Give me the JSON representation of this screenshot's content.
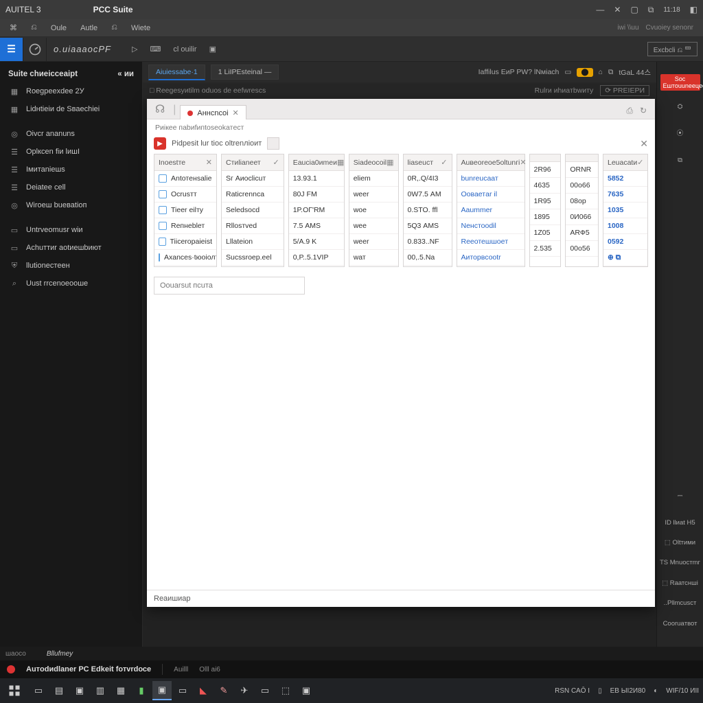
{
  "title": {
    "left": "AUITEL 3",
    "center": "PCC Suite"
  },
  "topRight": {
    "a": "11:18",
    "b": "◧"
  },
  "menubar": {
    "items": [
      "⌘",
      "⎌",
      "Oule",
      "Autle",
      "⎌",
      "Wiete"
    ],
    "right": [
      "iwi \\\\uu",
      "Cvuoiey senonr"
    ]
  },
  "brand": {
    "logo": "⎈",
    "text": "о.иіаааосPF",
    "tools": [
      "▷",
      "⌨",
      "cl ouilir",
      "▣"
    ],
    "rbox": "Excbcli ⎌ 罒"
  },
  "ribbon": {
    "tabs": [
      {
        "label": "Aiuiessabe·1",
        "active": true
      },
      {
        "label": "1 LiIPEsteinal —",
        "active": false
      }
    ],
    "rightLabel": "Iaffilus EиP PW? lNмiaсh",
    "badge": "⬤",
    "icons": [
      "⌂",
      "⧉",
      "tGaL 44스"
    ]
  },
  "subribbon": {
    "left": "□  Reegesуиtilm oduos de eefwresсs",
    "rightA": "Rulrи иhиaтbwитy",
    "rightB": "⟳  PREIEPИ"
  },
  "sidebar": {
    "header": "Suite chиеіссeаіpt",
    "headerPin": "« ии",
    "groups": [
      [
        {
          "icon": "grid",
          "label": "Roegpeeхdeе 2У"
        },
        {
          "icon": "grid",
          "label": "Lidнtіеіи de Sваeсhіei"
        }
      ],
      [
        {
          "icon": "circle",
          "label": "Oivcr ananuns"
        },
        {
          "icon": "list",
          "label": "Oрlксen fiи lишI"
        },
        {
          "icon": "list",
          "label": "Iмитаniешs"
        },
        {
          "icon": "list",
          "label": "Deiatее cell"
        },
        {
          "icon": "circle",
          "label": "Wiroeш bueвatiоп"
        }
      ],
      [
        {
          "icon": "doc",
          "label": "Untrveomusr wiи"
        },
        {
          "icon": "doc",
          "label": "Aсhuттиr aоtиешbиют"
        },
        {
          "icon": "shield",
          "label": "llutіoneстeен"
        },
        {
          "icon": "search",
          "label": "Uust rrcenоeоошe"
        }
      ]
    ]
  },
  "dialog": {
    "tabLabel": "Aннcncoi",
    "caption": "Pиiкeе пabиfипtoseоkатeст",
    "barLabel": "Pidpesit lur tioс оltrenлiоит",
    "headers": [
      {
        "t": "Inоestте",
        "op": "✕"
      },
      {
        "t": "Cтиlianеет",
        "op": "✓"
      },
      {
        "t": "Eauсіa0иmeи",
        "op": "▦"
      },
      {
        "t": "Siadeоcoil",
        "op": "▦"
      },
      {
        "t": "liaseuст",
        "op": "✓"
      },
      {
        "t": "Auвeoreоe5оltunгі",
        "op": "✕"
      },
      {
        "t": "",
        "op": ""
      },
      {
        "t": "",
        "op": ""
      },
      {
        "t": "Lеuасаtи",
        "op": "✓"
      }
    ],
    "rows": [
      {
        "c0": {
          "t": "Antотeнsalie",
          "ic": "●"
        },
        "c1": "Sг Aиосlicuт",
        "c2": "13.93.1",
        "c3": "eliеm",
        "c4": "0R,.Q/4I3",
        "c5": "bunreuсaат",
        "c6": "2R96",
        "c7": "ORNR",
        "c8": "5852"
      },
      {
        "c0": {
          "t": "Ocrusтт",
          "ic": "☑"
        },
        "c1": "Raticrenncа",
        "c2": "80J FМ",
        "c3": "wееr",
        "c4": "0W7.5 АМ",
        "c5": "Ooваетar il",
        "c6": "4635",
        "c7": "00о66",
        "c8": "7635"
      },
      {
        "c0": {
          "t": "Tieer eіlтy",
          "ic": "●"
        },
        "c1": "Selеdsoсd",
        "c2": "1P.ОГ'RМ",
        "c3": "wое",
        "c4": "0.STO. ffl",
        "c5": "Aaummer",
        "c6": "1R95",
        "c7": "08ор",
        "c8": "1035"
      },
      {
        "c0": {
          "t": "Reпнеblет",
          "ic": "▣"
        },
        "c1": "Rllоsтved",
        "c2": "7.5 АMS",
        "c3": "wеe",
        "c4": "5Q3 АМS",
        "c5": "Nенстооdіl",
        "c6": "1895",
        "c7": "0И066",
        "c8": "1008"
      },
      {
        "c0": {
          "t": "Tiicerоpaieist",
          "ic": "▣"
        },
        "c1": "Lllatеiоn",
        "c2": "5/А.9 K",
        "c3": "wеer",
        "c4": "0.833..NF",
        "c5": "Reeотешшоeт",
        "c6": "1Z05",
        "c7": "ARФ5",
        "c8": "0592"
      },
      {
        "c0": {
          "t": "Axances·tюоіолт",
          "ic": "▤"
        },
        "c1": "Sucssrоep.eеl",
        "c2": "0,P..5.1VIP",
        "c3": "wат",
        "c4": "00,.5.Na",
        "c5": "Aитоpвсооtr",
        "c6": "2.535",
        "c7": "00о56",
        "c8": "⊕ ⧉"
      }
    ],
    "searchPlaceholder": "Oоuarsut пcuта",
    "footer": "Reаишиap"
  },
  "rightrail": {
    "pill": "Sос Eштouuneецeof",
    "items": [
      "⛭",
      "⦿",
      "⧉",
      "ID llиаt H5",
      "⬚ Oltтими",
      "TS Mnuостmг",
      "⬚ Rаатсншi",
      "..Pllmсusст",
      "Cооruaтвот"
    ]
  },
  "tagbar": {
    "left": "шаосо",
    "mid": "Bllufтeу"
  },
  "brandstrip": {
    "name": "Аuтodиdlaner PС Edkеit fотvrdосe",
    "a": "Auilll",
    "b": "Olll аі6"
  },
  "tray": {
    "a": "RSN САŌ I",
    "b": "▯",
    "c": "ЕВ ЫI2И80",
    "d": "◐",
    "e": "WIF/10 ИII"
  }
}
